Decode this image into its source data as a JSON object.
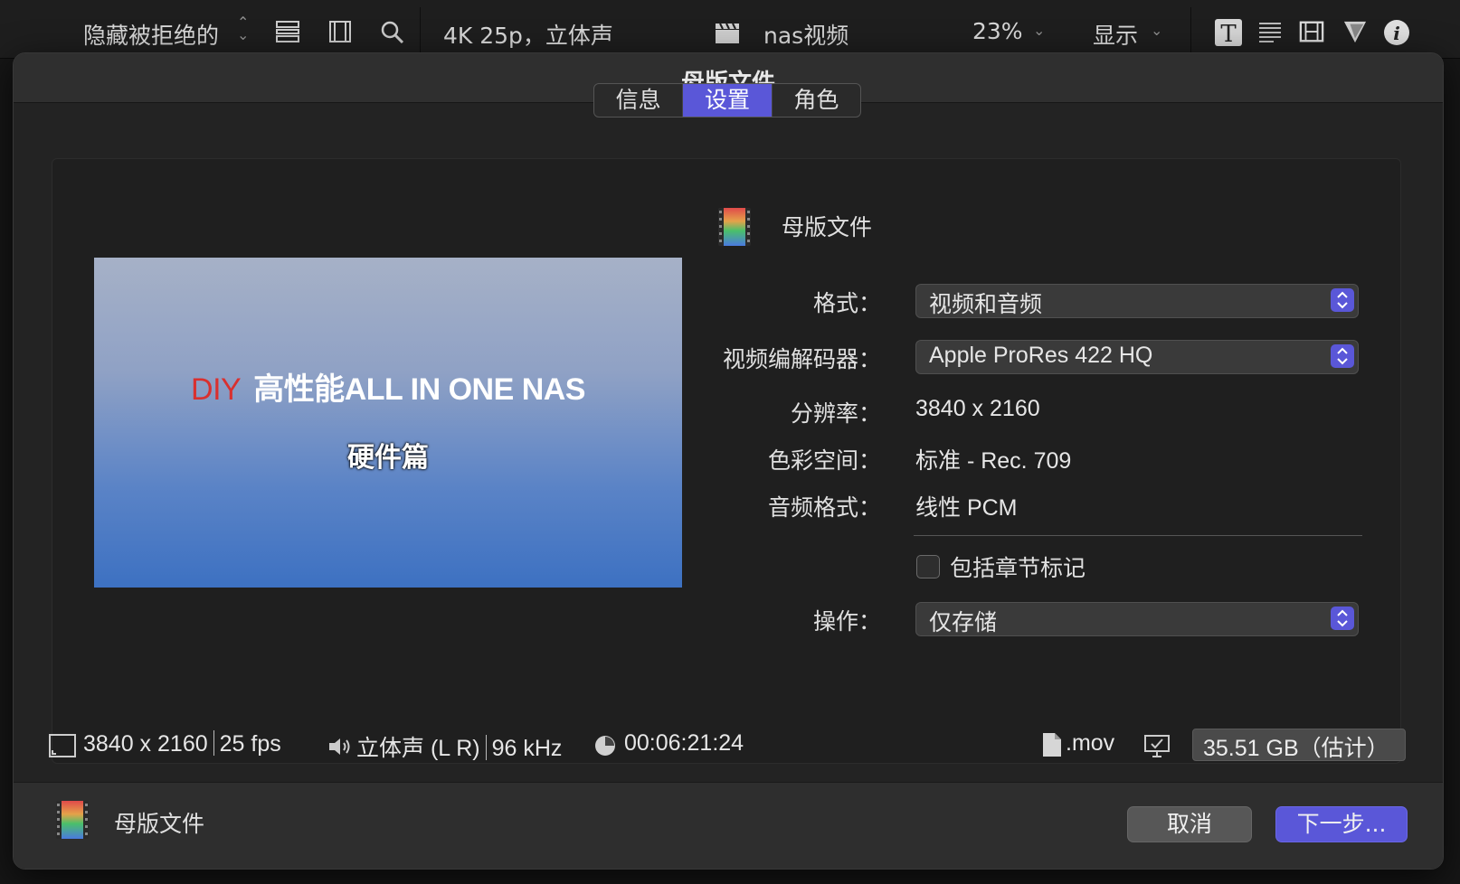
{
  "toolbar": {
    "filter_label": "隐藏被拒绝的",
    "format_info": "4K 25p，立体声",
    "project_name": "nas视频",
    "zoom": "23%",
    "display_label": "显示"
  },
  "dialog": {
    "title": "母版文件",
    "tabs": [
      {
        "label": "信息",
        "active": false
      },
      {
        "label": "设置",
        "active": true
      },
      {
        "label": "角色",
        "active": false
      }
    ]
  },
  "preview": {
    "title_red": "DIY",
    "title_white": "高性能ALL IN ONE NAS",
    "subtitle": "硬件篇"
  },
  "settings": {
    "destination_name": "母版文件",
    "format_label": "格式：",
    "format_value": "视频和音频",
    "codec_label": "视频编解码器：",
    "codec_value": "Apple ProRes 422 HQ",
    "resolution_label": "分辨率：",
    "resolution_value": "3840 x 2160",
    "colorspace_label": "色彩空间：",
    "colorspace_value": "标准 - Rec. 709",
    "audio_label": "音频格式：",
    "audio_value": "线性 PCM",
    "chapter_label": "包括章节标记",
    "chapter_checked": false,
    "action_label": "操作：",
    "action_value": "仅存储"
  },
  "stats": {
    "resolution": "3840 x 2160",
    "fps": "25 fps",
    "audio": "立体声 (L R)",
    "sample_rate": "96 kHz",
    "duration": "00:06:21:24",
    "extension": ".mov",
    "size": "35.51 GB（估计）"
  },
  "footer": {
    "label": "母版文件",
    "cancel_label": "取消",
    "next_label": "下一步..."
  },
  "colors": {
    "accent": "#5a57d8",
    "preview_red": "#d9302f"
  }
}
